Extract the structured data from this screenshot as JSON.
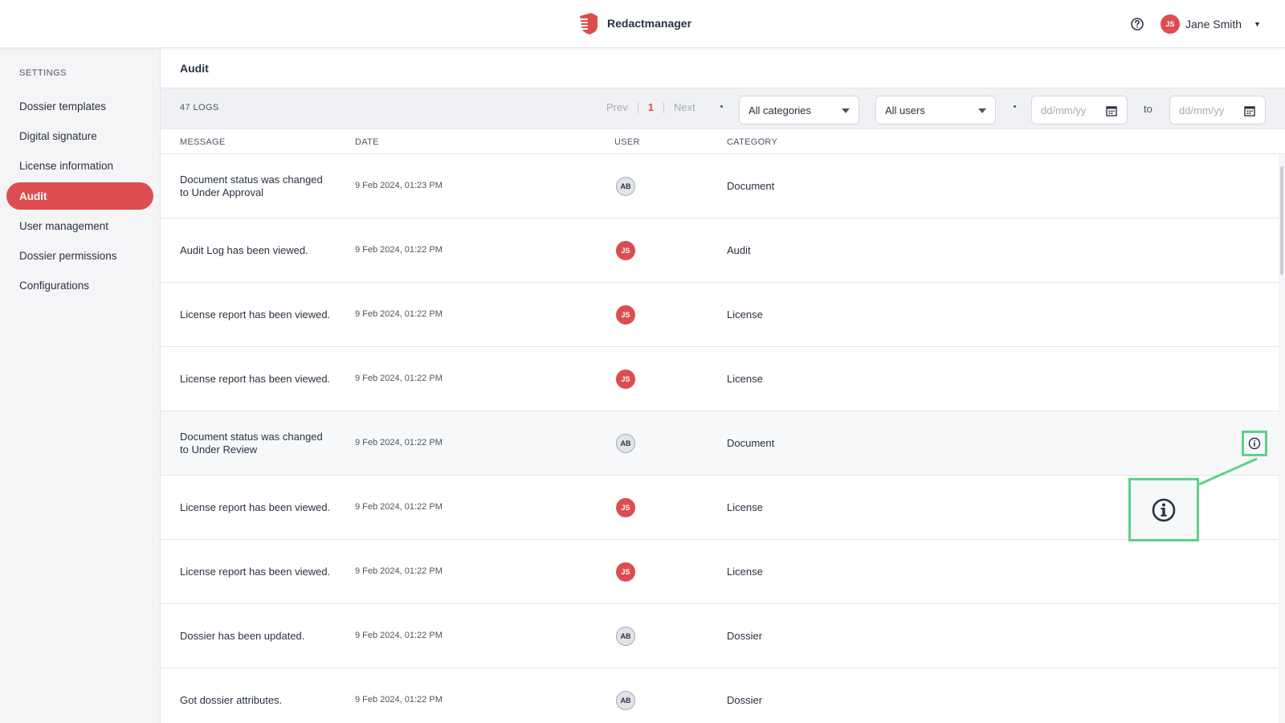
{
  "app": {
    "name": "Redactmanager",
    "brand_color": "#dd4d50"
  },
  "topbar": {
    "help_icon": "help-circle-icon",
    "user": {
      "initials": "JS",
      "name": "Jane Smith"
    }
  },
  "sidebar": {
    "heading": "SETTINGS",
    "items": [
      {
        "label": "Dossier templates"
      },
      {
        "label": "Digital signature"
      },
      {
        "label": "License information"
      },
      {
        "label": "Audit",
        "active": true
      },
      {
        "label": "User management"
      },
      {
        "label": "Dossier permissions"
      },
      {
        "label": "Configurations"
      }
    ]
  },
  "page": {
    "title": "Audit"
  },
  "toolbar": {
    "log_count": "47 LOGS",
    "pager": {
      "prev": "Prev",
      "current": "1",
      "next": "Next"
    },
    "category_select": "All categories",
    "user_select": "All users",
    "date_from_placeholder": "dd/mm/yy",
    "to_label": "to",
    "date_to_placeholder": "dd/mm/yy"
  },
  "table": {
    "columns": [
      "MESSAGE",
      "DATE",
      "USER",
      "CATEGORY"
    ],
    "rows": [
      {
        "message": "Document status was changed to Under Approval",
        "date": "9 Feb 2024, 01:23 PM",
        "user": "AB",
        "category": "Document"
      },
      {
        "message": "Audit Log has been viewed.",
        "date": "9 Feb 2024, 01:22 PM",
        "user": "JS",
        "category": "Audit"
      },
      {
        "message": "License report has been viewed.",
        "date": "9 Feb 2024, 01:22 PM",
        "user": "JS",
        "category": "License"
      },
      {
        "message": "License report has been viewed.",
        "date": "9 Feb 2024, 01:22 PM",
        "user": "JS",
        "category": "License"
      },
      {
        "message": "Document status was changed to Under Review",
        "date": "9 Feb 2024, 01:22 PM",
        "user": "AB",
        "category": "Document"
      },
      {
        "message": "License report has been viewed.",
        "date": "9 Feb 2024, 01:22 PM",
        "user": "JS",
        "category": "License"
      },
      {
        "message": "License report has been viewed.",
        "date": "9 Feb 2024, 01:22 PM",
        "user": "JS",
        "category": "License"
      },
      {
        "message": "Dossier has been updated.",
        "date": "9 Feb 2024, 01:22 PM",
        "user": "AB",
        "category": "Dossier"
      },
      {
        "message": "Got dossier attributes.",
        "date": "9 Feb 2024, 01:22 PM",
        "user": "AB",
        "category": "Dossier"
      }
    ]
  },
  "highlight": {
    "color": "#5fd08a",
    "icon": "info-icon"
  }
}
